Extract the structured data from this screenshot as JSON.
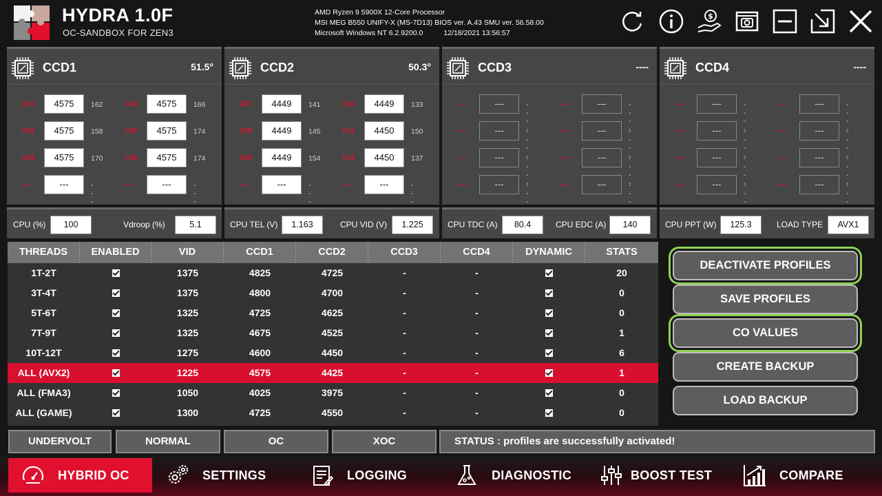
{
  "header": {
    "title": "HYDRA 1.0F",
    "subtitle": "OC-SANDBOX FOR ZEN3",
    "cpu": "AMD Ryzen 9 5900X 12-Core Processor",
    "board": "MSI MEG B550 UNIFY-X (MS-7D13) BIOS ver. A.43 SMU ver. 56.58.00",
    "os": "Microsoft Windows NT 6.2.9200.0",
    "datetime": "12/18/2021 13:56:57"
  },
  "ccds": [
    {
      "name": "CCD1",
      "temp": "51.5°",
      "cores": [
        {
          "label": "C01",
          "freq": "4575",
          "val": "162"
        },
        {
          "label": "C02",
          "freq": "4575",
          "val": "158"
        },
        {
          "label": "C03",
          "freq": "4575",
          "val": "170"
        },
        {
          "label": "----",
          "freq": "---",
          "val": "----"
        },
        {
          "label": "C04",
          "freq": "4575",
          "val": "166"
        },
        {
          "label": "C05",
          "freq": "4575",
          "val": "174"
        },
        {
          "label": "C06",
          "freq": "4575",
          "val": "174"
        },
        {
          "label": "----",
          "freq": "---",
          "val": "----"
        }
      ]
    },
    {
      "name": "CCD2",
      "temp": "50.3°",
      "cores": [
        {
          "label": "C07",
          "freq": "4449",
          "val": "141"
        },
        {
          "label": "C08",
          "freq": "4449",
          "val": "145"
        },
        {
          "label": "C09",
          "freq": "4449",
          "val": "154"
        },
        {
          "label": "----",
          "freq": "---",
          "val": "----"
        },
        {
          "label": "C10",
          "freq": "4449",
          "val": "133"
        },
        {
          "label": "C11",
          "freq": "4450",
          "val": "150"
        },
        {
          "label": "C12",
          "freq": "4450",
          "val": "137"
        },
        {
          "label": "----",
          "freq": "---",
          "val": "----"
        }
      ]
    },
    {
      "name": "CCD3",
      "temp": "----",
      "cores": [
        {
          "label": "----",
          "freq": "---",
          "val": "----"
        },
        {
          "label": "----",
          "freq": "---",
          "val": "----"
        },
        {
          "label": "----",
          "freq": "---",
          "val": "----"
        },
        {
          "label": "----",
          "freq": "---",
          "val": "----"
        },
        {
          "label": "----",
          "freq": "---",
          "val": "----"
        },
        {
          "label": "----",
          "freq": "---",
          "val": "----"
        },
        {
          "label": "----",
          "freq": "---",
          "val": "----"
        },
        {
          "label": "----",
          "freq": "---",
          "val": "----"
        }
      ]
    },
    {
      "name": "CCD4",
      "temp": "----",
      "cores": [
        {
          "label": "----",
          "freq": "---",
          "val": "----"
        },
        {
          "label": "----",
          "freq": "---",
          "val": "----"
        },
        {
          "label": "----",
          "freq": "---",
          "val": "----"
        },
        {
          "label": "----",
          "freq": "---",
          "val": "----"
        },
        {
          "label": "----",
          "freq": "---",
          "val": "----"
        },
        {
          "label": "----",
          "freq": "---",
          "val": "----"
        },
        {
          "label": "----",
          "freq": "---",
          "val": "----"
        },
        {
          "label": "----",
          "freq": "---",
          "val": "----"
        }
      ]
    }
  ],
  "params": [
    {
      "l1": "CPU (%)",
      "v1": "100",
      "l2": "Vdroop (%)",
      "v2": "5.1"
    },
    {
      "l1": "CPU TEL (V)",
      "v1": "1.163",
      "l2": "CPU VID (V)",
      "v2": "1.225"
    },
    {
      "l1": "CPU TDC (A)",
      "v1": "80.4",
      "l2": "CPU EDC (A)",
      "v2": "140"
    },
    {
      "l1": "CPU PPT (W)",
      "v1": "125.3",
      "l2": "LOAD TYPE",
      "v2": "AVX1"
    }
  ],
  "table": {
    "headers": [
      "THREADS",
      "ENABLED",
      "VID",
      "CCD1",
      "CCD2",
      "CCD3",
      "CCD4",
      "DYNAMIC",
      "STATS"
    ],
    "rows": [
      {
        "threads": "1T-2T",
        "vid": "1375",
        "ccd1": "4825",
        "ccd2": "4725",
        "ccd3": "-",
        "ccd4": "-",
        "stats": "20"
      },
      {
        "threads": "3T-4T",
        "vid": "1375",
        "ccd1": "4800",
        "ccd2": "4700",
        "ccd3": "-",
        "ccd4": "-",
        "stats": "0"
      },
      {
        "threads": "5T-6T",
        "vid": "1325",
        "ccd1": "4725",
        "ccd2": "4625",
        "ccd3": "-",
        "ccd4": "-",
        "stats": "0"
      },
      {
        "threads": "7T-9T",
        "vid": "1325",
        "ccd1": "4675",
        "ccd2": "4525",
        "ccd3": "-",
        "ccd4": "-",
        "stats": "1"
      },
      {
        "threads": "10T-12T",
        "vid": "1275",
        "ccd1": "4600",
        "ccd2": "4450",
        "ccd3": "-",
        "ccd4": "-",
        "stats": "6"
      },
      {
        "threads": "ALL (AVX2)",
        "vid": "1225",
        "ccd1": "4575",
        "ccd2": "4425",
        "ccd3": "-",
        "ccd4": "-",
        "stats": "1"
      },
      {
        "threads": "ALL (FMA3)",
        "vid": "1050",
        "ccd1": "4025",
        "ccd2": "3975",
        "ccd3": "-",
        "ccd4": "-",
        "stats": "0"
      },
      {
        "threads": "ALL (GAME)",
        "vid": "1300",
        "ccd1": "4725",
        "ccd2": "4550",
        "ccd3": "-",
        "ccd4": "-",
        "stats": "0"
      }
    ]
  },
  "actions": {
    "deactivate": "DEACTIVATE PROFILES",
    "save": "SAVE PROFILES",
    "co": "CO VALUES",
    "create_backup": "CREATE BACKUP",
    "load_backup": "LOAD BACKUP"
  },
  "modes": {
    "undervolt": "UNDERVOLT",
    "normal": "NORMAL",
    "oc": "OC",
    "xoc": "XOC"
  },
  "status": "STATUS : profiles are successfully activated!",
  "nav": {
    "hybrid": "HYBRID OC",
    "settings": "SETTINGS",
    "logging": "LOGGING",
    "diagnostic": "DIAGNOSTIC",
    "boost": "BOOST TEST",
    "compare": "COMPARE"
  },
  "colors": {
    "accent_red": "#e0102e",
    "selection_green": "#8fd256",
    "panel_gray": "#464646"
  }
}
